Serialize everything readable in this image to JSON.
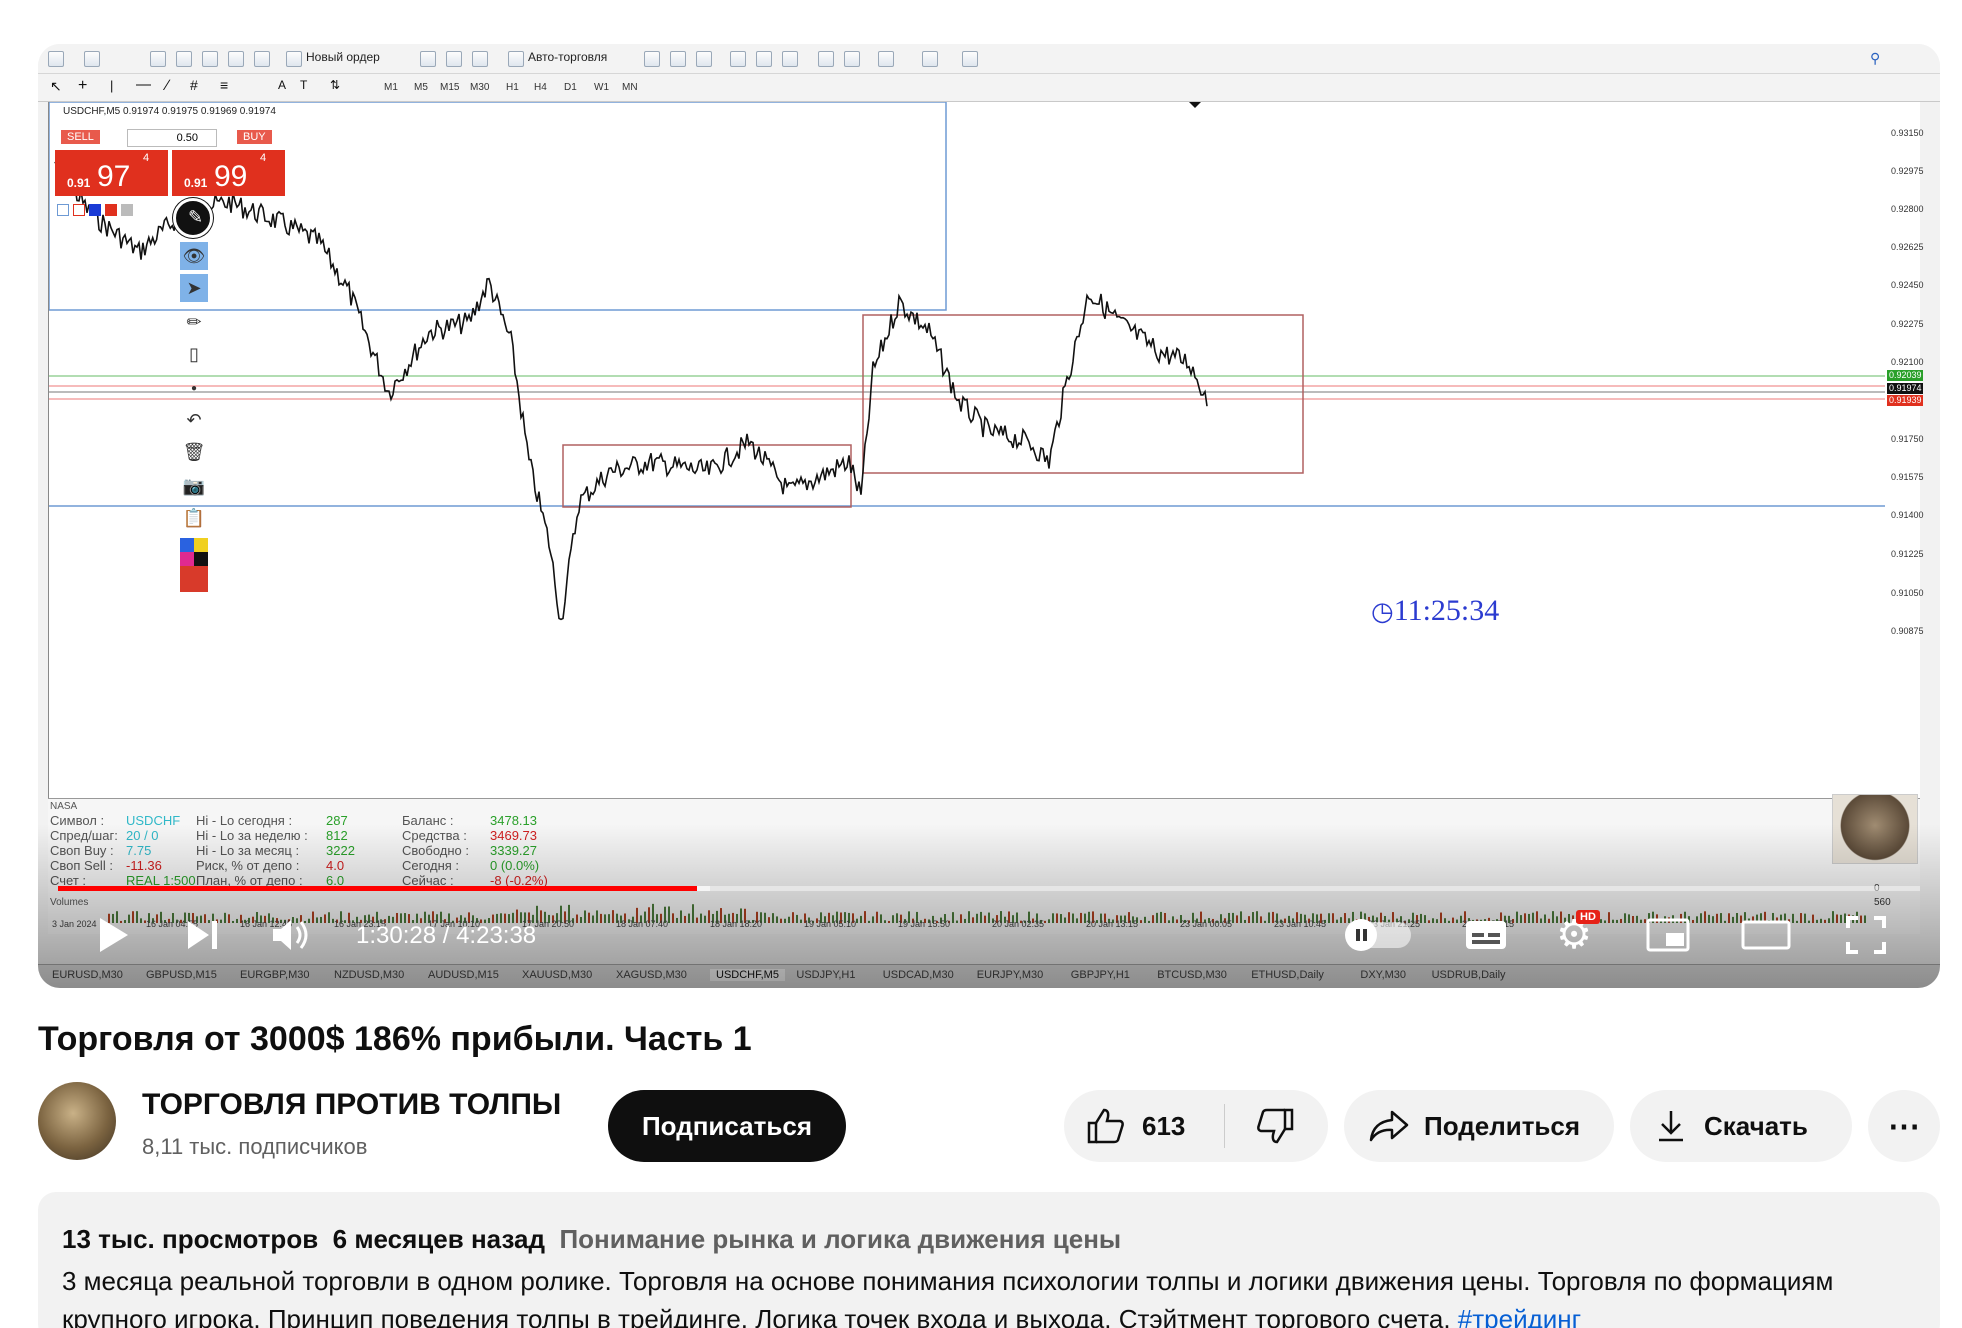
{
  "terminal_app": {
    "toolbar": {
      "new_order": "Новый ордер",
      "auto_trading": "Авто-торговля",
      "timeframes": [
        "M1",
        "M5",
        "M15",
        "M30",
        "H1",
        "H4",
        "D1",
        "W1",
        "MN"
      ]
    },
    "symbol_header": "USDCHF,M5  0.91974 0.91975 0.91969 0.91974",
    "trade_panel": {
      "sell_label": "SELL",
      "buy_label": "BUY",
      "lot": "0.50",
      "sell_price_small": "0.91",
      "sell_price_big": "97",
      "sell_price_sup": "4",
      "buy_price_small": "0.91",
      "buy_price_big": "99",
      "buy_price_sup": "4"
    },
    "clock": "11:25:34",
    "price_axis": [
      "0.93150",
      "0.92975",
      "0.92800",
      "0.92625",
      "0.92450",
      "0.92275",
      "0.92100",
      "0.91750",
      "0.91575",
      "0.91400",
      "0.91225",
      "0.91050",
      "0.90875"
    ],
    "price_flags": {
      "green": "0.92039",
      "black": "0.91974",
      "red": "0.91939",
      "colors": {
        "green": "#2aa02a",
        "black": "#111111",
        "red": "#e0301e"
      }
    },
    "indicator_zero": "0",
    "volume_axis": "560",
    "volumes_label": "Volumes",
    "nasa_label": "NASA",
    "stats": {
      "rows": [
        {
          "k1": "Символ :",
          "v1": "USDCHF",
          "k2": "Hi - Lo сегодня :",
          "v2": "287",
          "k3": "Баланс :",
          "v3": "3478.13"
        },
        {
          "k1": "Спред/шаг:",
          "v1": "20 / 0",
          "k2": "Hi - Lo за неделю :",
          "v2": "812",
          "k3": "Средства :",
          "v3": "3469.73"
        },
        {
          "k1": "Своп Buy :",
          "v1": "7.75",
          "k2": "Hi - Lo за месяц :",
          "v2": "3222",
          "k3": "Свободно :",
          "v3": "3339.27"
        },
        {
          "k1": "Своп Sell :",
          "v1": "-11.36",
          "k2": "Риск, % от депо :",
          "v2": "4.0",
          "k3": "Сегодня :",
          "v3": "0 (0.0%)"
        },
        {
          "k1": "Счет :",
          "v1": "REAL  1:500",
          "k2": "План, % от депо :",
          "v2": "6.0",
          "k3": "Сейчас :",
          "v3": "-8 (-0.2%)"
        }
      ]
    },
    "time_axis": [
      "3 Jan 2024",
      "16 Jan 04:55",
      "16 Jan 12:45",
      "16 Jan 23:15",
      "17 Jan 10:10",
      "17 Jan 20:50",
      "18 Jan 07:40",
      "18 Jan 18:20",
      "19 Jan 05:10",
      "19 Jan 15:50",
      "20 Jan 02:35",
      "20 Jan 13:15",
      "23 Jan 00:05",
      "23 Jan 10:45",
      "23 Jan 21:25",
      "24 Jan 08:15"
    ],
    "symbol_tabs": [
      "EURUSD,M30",
      "GBPUSD,M15",
      "EURGBP,M30",
      "NZDUSD,M30",
      "AUDUSD,M15",
      "XAUUSD,M30",
      "XAGUSD,M30",
      "USDCHF,M5",
      "USDJPY,H1",
      "USDCAD,M30",
      "EURJPY,M30",
      "GBPJPY,H1",
      "BTCUSD,M30",
      "ETHUSD,Daily",
      "DXY,M30",
      "USDRUB,Daily"
    ],
    "active_tab": "USDCHF,M5"
  },
  "player": {
    "time_display": "1:30:28 / 4:23:38",
    "progress_fraction": 0.343,
    "buffer_fraction": 0.35,
    "hd_badge": "HD",
    "accent_color": "#ff0000"
  },
  "video": {
    "title": "Торговля от 3000$ 186% прибыли. Часть 1",
    "channel_name": "ТОРГОВЛЯ ПРОТИВ ТОЛПЫ",
    "subscribers": "8,11 тыс. подписчиков",
    "subscribe_label": "Подписаться",
    "likes": "613",
    "share_label": "Поделиться",
    "download_label": "Скачать",
    "more_label": "⋯",
    "views": "13 тыс. просмотров",
    "date": "6 месяцев назад",
    "category": "Понимание рынка и логика движения цены",
    "description": "3 месяца реальной торговли в одном ролике. Торговля на основе понимания психологии толпы и логики движения цены. Торговля по формациям крупного игрока. Принцип поведения толпы в трейдинге. Логика точек входа и выхода. Стэйтмент торгового счета.",
    "hashtag": "#трейдинг"
  }
}
